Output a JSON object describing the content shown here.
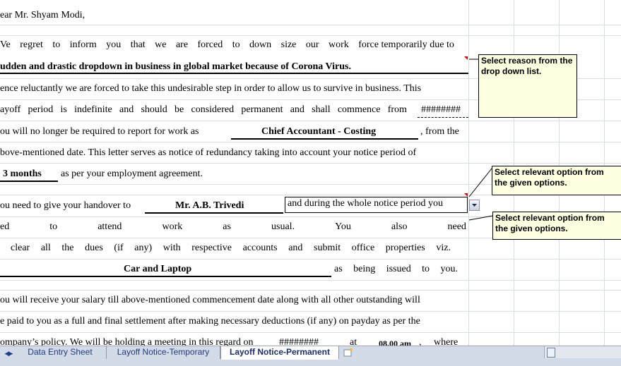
{
  "letter": {
    "salutation": "ear  Mr. Shyam Modi,",
    "p1_line1": "Ve regret to inform you that we are forced to down size our work force temporarily due to",
    "p1_line1_words": [
      "Ve",
      "regret",
      "to",
      "inform",
      "you",
      "that",
      "we",
      "are",
      "forced",
      "to",
      "down",
      "size",
      "our",
      "work",
      "force temporarily due to"
    ],
    "p1_reason": "udden and drastic dropdown in business in global market because of Corona Virus.",
    "p1_line3": "ence reluctantly we are forced to take this undesirable step in order to allow us to survive in business. This",
    "p1_line4_words": [
      "ayoff",
      "period",
      "is",
      "indefinite",
      "and",
      "should",
      "be",
      "considered",
      "permanent",
      "and",
      "shall",
      "commence",
      "from"
    ],
    "date_value": "########",
    "p1_line5_pre": "ou will  no  longer be required  to report  for  work  as",
    "designation": "Chief Accountant - Costing",
    "p1_line5_post": ", from the",
    "p1_line6": "bove-mentioned date.  This letter serves as notice of redundancy taking into account your notice period of",
    "notice_period": "3 months",
    "p1_line7_post": "as per your employment agreement.",
    "handover_pre": "ou need to give your handover to",
    "handover_person": "Mr. A.B. Trivedi",
    "handover_option": "and during the whole notice period you",
    "p2_line2_words": [
      "ed",
      "to",
      "attend",
      "work",
      "as",
      "usual.",
      "You",
      "also",
      "need"
    ],
    "p2_line3_words": [
      "clear",
      "all",
      "the",
      "dues",
      "(if",
      "any)",
      "with",
      "respective",
      "accounts",
      "and",
      "submit",
      "office",
      "properties",
      "viz."
    ],
    "properties": "Car and Laptop",
    "p2_line4_words": [
      "as",
      "being",
      "issued",
      "to",
      "you."
    ],
    "p3_line1": "ou will  receive your salary till above-mentioned commencement date along with all other outstanding will",
    "p3_line2": "e paid to you as a full and final settlement after making necessary deductions (if any) on payday as per the",
    "p3_line3_pre": "ompany’s  policy.  We  will  be holding a meeting in this regard  on",
    "meeting_date": "########",
    "at_word": "at",
    "meeting_time": "08.00 am",
    "p3_line3_comma": ",",
    "where_word": "where"
  },
  "comments": {
    "reason": "Select reason from the drop down list.",
    "option1": "Select relevant option from the given options.",
    "option2": "Select relevant option from the given options."
  },
  "tabs": {
    "data_entry": "Data Entry Sheet",
    "layoff_temp": "Layoff Notice-Temporary",
    "layoff_perm": "Layoff Notice-Permanent"
  },
  "icons": {
    "nav_prev": "triangle-left-icon",
    "nav_next": "triangle-right-icon",
    "dropdown": "chevron-down-icon",
    "new_sheet": "insert-worksheet-icon"
  },
  "colors": {
    "comment_bg": "#ffffe1",
    "indicator_red": "#e00000",
    "tabbar_bg": "#d4dbe8",
    "tab_text": "#203a7a"
  }
}
